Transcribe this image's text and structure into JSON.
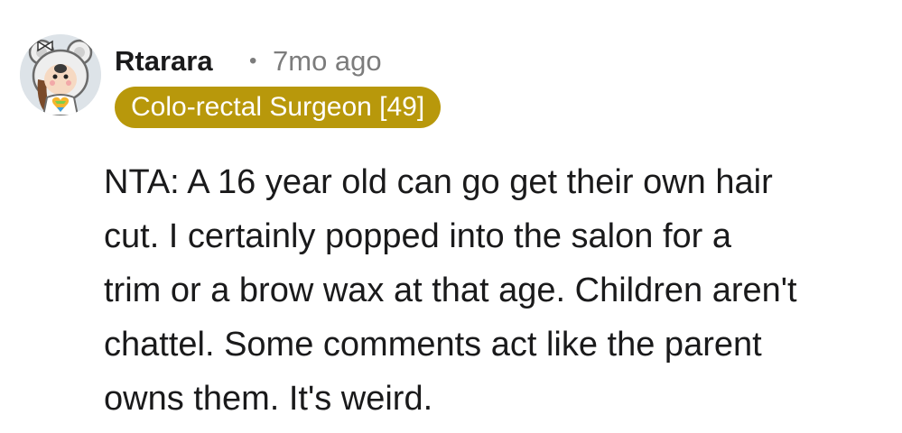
{
  "comment": {
    "avatar_icon": "koala-hood-avatar-icon",
    "username": "Rtarara",
    "separator": "•",
    "timestamp": "7mo ago",
    "flair": {
      "text": "Colo-rectal Surgeon [49]",
      "color": "#b8980b"
    },
    "body_lines": [
      "NTA: A 16 year old can go get their own hair",
      "cut. I certainly popped into the salon for a",
      "trim or a brow wax at that age. Children aren't",
      "chattel. Some comments act like the parent",
      "owns them. It's weird."
    ]
  }
}
